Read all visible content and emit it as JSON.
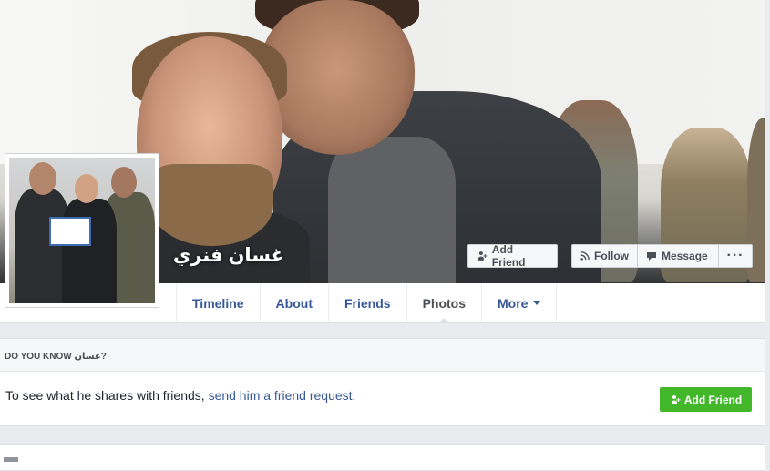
{
  "profile": {
    "name": "غسان فنري"
  },
  "cover_actions": {
    "add_friend": "Add Friend",
    "follow": "Follow",
    "message": "Message",
    "more": "···"
  },
  "tabs": [
    {
      "label": "Timeline"
    },
    {
      "label": "About"
    },
    {
      "label": "Friends"
    },
    {
      "label": "Photos",
      "active": true
    },
    {
      "label": "More"
    }
  ],
  "know_box": {
    "heading_prefix": "DO YOU KNOW ",
    "heading_name": "غسان",
    "heading_suffix": "?",
    "text_prefix": "To see what he shares with friends, ",
    "link_text": "send him a friend request.",
    "button_label": "Add Friend"
  },
  "colors": {
    "link_blue": "#365899",
    "green_button": "#42b72a",
    "page_bg": "#e9ebee"
  }
}
